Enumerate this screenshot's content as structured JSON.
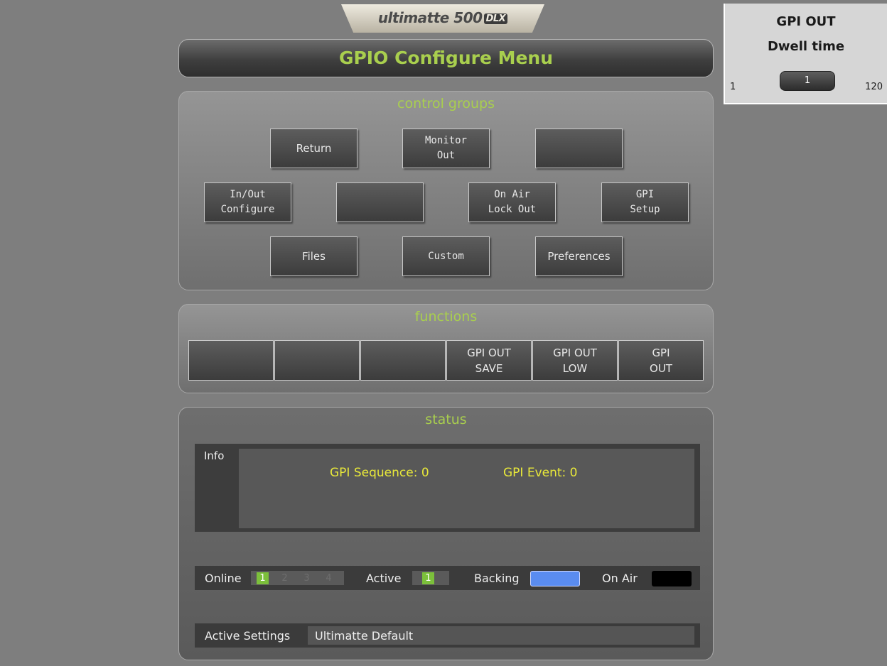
{
  "logo": {
    "brand": "ultimatte 500",
    "badge": "DLX"
  },
  "menu_title": "GPIO Configure Menu",
  "control_groups": {
    "title": "control groups",
    "buttons": {
      "return": "Return",
      "monitor_out": "Monitor\nOut",
      "blank_1": "",
      "inout_configure": "In/Out\nConfigure",
      "blank_2": "",
      "on_air_lock_out": "On Air\nLock Out",
      "gpi_setup": "GPI\nSetup",
      "files": "Files",
      "custom": "Custom",
      "preferences": "Preferences"
    }
  },
  "functions": {
    "title": "functions",
    "buttons": [
      "",
      "",
      "",
      "GPI OUT\nSAVE",
      "GPI OUT\nLOW",
      "GPI\nOUT"
    ]
  },
  "status": {
    "title": "status",
    "info_label": "Info",
    "gpi_sequence": "GPI Sequence: 0",
    "gpi_event": "GPI Event: 0",
    "online_label": "Online",
    "online_numbers": [
      "1",
      "2",
      "3",
      "4"
    ],
    "online_active_index": 0,
    "active_label": "Active",
    "active_value": "1",
    "backing_label": "Backing",
    "backing_color": "#5a8cf0",
    "on_air_label": "On Air",
    "on_air_color": "#000000",
    "active_settings_label": "Active Settings",
    "active_settings_value": "Ultimatte Default"
  },
  "side_panel": {
    "title": "GPI OUT",
    "subtitle": "Dwell time",
    "min": "1",
    "value": "1",
    "max": "120"
  }
}
